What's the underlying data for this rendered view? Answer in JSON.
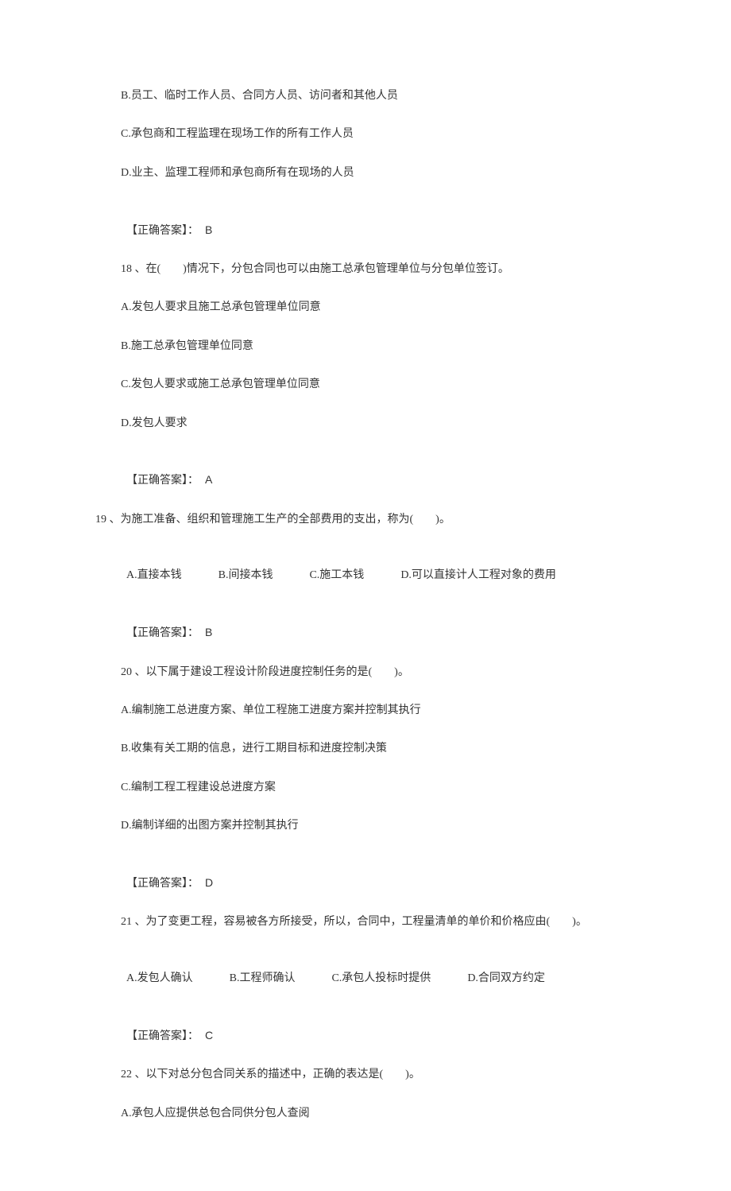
{
  "q17": {
    "optB": "B.员工、临时工作人员、合同方人员、访问者和其他人员",
    "optC": "C.承包商和工程监理在现场工作的所有工作人员",
    "optD": "D.业主、监理工程师和承包商所有在现场的人员",
    "answerLabel": "【正确答案】：",
    "answerValue": "B"
  },
  "q18": {
    "stem": "18 、在(　　)情况下，分包合同也可以由施工总承包管理单位与分包单位签订。",
    "optA": "A.发包人要求且施工总承包管理单位同意",
    "optB": "B.施工总承包管理单位同意",
    "optC": "C.发包人要求或施工总承包管理单位同意",
    "optD": "D.发包人要求",
    "answerLabel": "【正确答案】：",
    "answerValue": "A"
  },
  "q19": {
    "stem": "19 、为施工准备、组织和管理施工生产的全部费用的支出，称为(　　)。",
    "optA": "A.直接本钱",
    "optB": "B.间接本钱",
    "optC": "C.施工本钱",
    "optD": "D.可以直接计人工程对象的费用",
    "answerLabel": "【正确答案】：",
    "answerValue": "B"
  },
  "q20": {
    "stem": "20 、以下属于建设工程设计阶段进度控制任务的是(　　)。",
    "optA": "A.编制施工总进度方案、单位工程施工进度方案并控制其执行",
    "optB": "B.收集有关工期的信息，进行工期目标和进度控制决策",
    "optC": "C.编制工程工程建设总进度方案",
    "optD": "D.编制详细的出图方案并控制其执行",
    "answerLabel": "【正确答案】：",
    "answerValue": "D"
  },
  "q21": {
    "stem": "21 、为了变更工程，容易被各方所接受，所以，合同中，工程量清单的单价和价格应由(　　)。",
    "optA": "A.发包人确认",
    "optB": "B.工程师确认",
    "optC": "C.承包人投标时提供",
    "optD": "D.合同双方约定",
    "answerLabel": "【正确答案】：",
    "answerValue": "C"
  },
  "q22": {
    "stem": "22 、以下对总分包合同关系的描述中，正确的表达是(　　)。",
    "optA": "A.承包人应提供总包合同供分包人查阅"
  }
}
